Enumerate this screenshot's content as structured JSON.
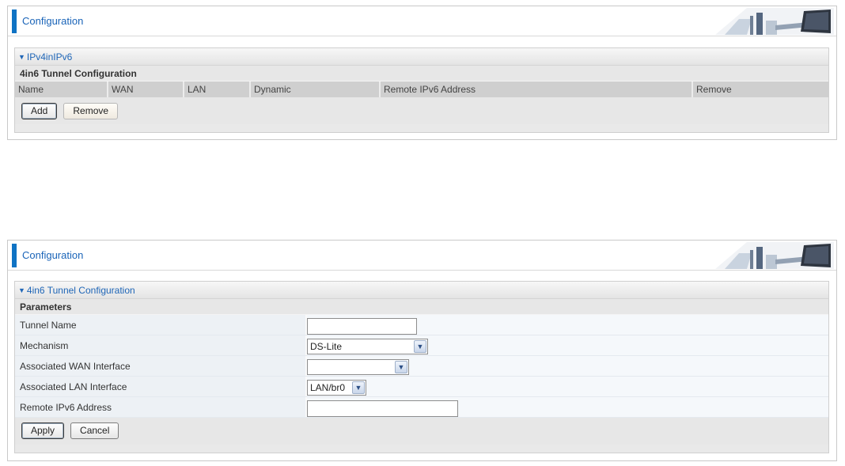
{
  "top_panel": {
    "header_title": "Configuration",
    "section_title": "IPv4inIPv6",
    "subheading": "4in6 Tunnel Configuration",
    "columns": [
      "Name",
      "WAN",
      "LAN",
      "Dynamic",
      "Remote IPv6 Address",
      "Remove"
    ],
    "add_label": "Add",
    "remove_label": "Remove"
  },
  "bottom_panel": {
    "header_title": "Configuration",
    "section_title": "4in6 Tunnel Configuration",
    "subheading": "Parameters",
    "params": [
      {
        "label": "Tunnel Name",
        "type": "text",
        "value": ""
      },
      {
        "label": "Mechanism",
        "type": "select",
        "value": "DS-Lite"
      },
      {
        "label": "Associated WAN Interface",
        "type": "select",
        "value": ""
      },
      {
        "label": "Associated LAN Interface",
        "type": "select",
        "value": "LAN/br0"
      },
      {
        "label": "Remote IPv6 Address",
        "type": "text",
        "value": ""
      }
    ],
    "apply_label": "Apply",
    "cancel_label": "Cancel"
  },
  "icons": {
    "section_toggle": "triangle-down-icon",
    "select_arrow": "chevron-down-icon",
    "header_art": "computer-monitor-icon"
  },
  "colors": {
    "accent": "#0f73c4",
    "title_text": "#1a64b8",
    "column_header_bg": "#cfcfcf",
    "field_row_bg": "#edf1f5"
  }
}
